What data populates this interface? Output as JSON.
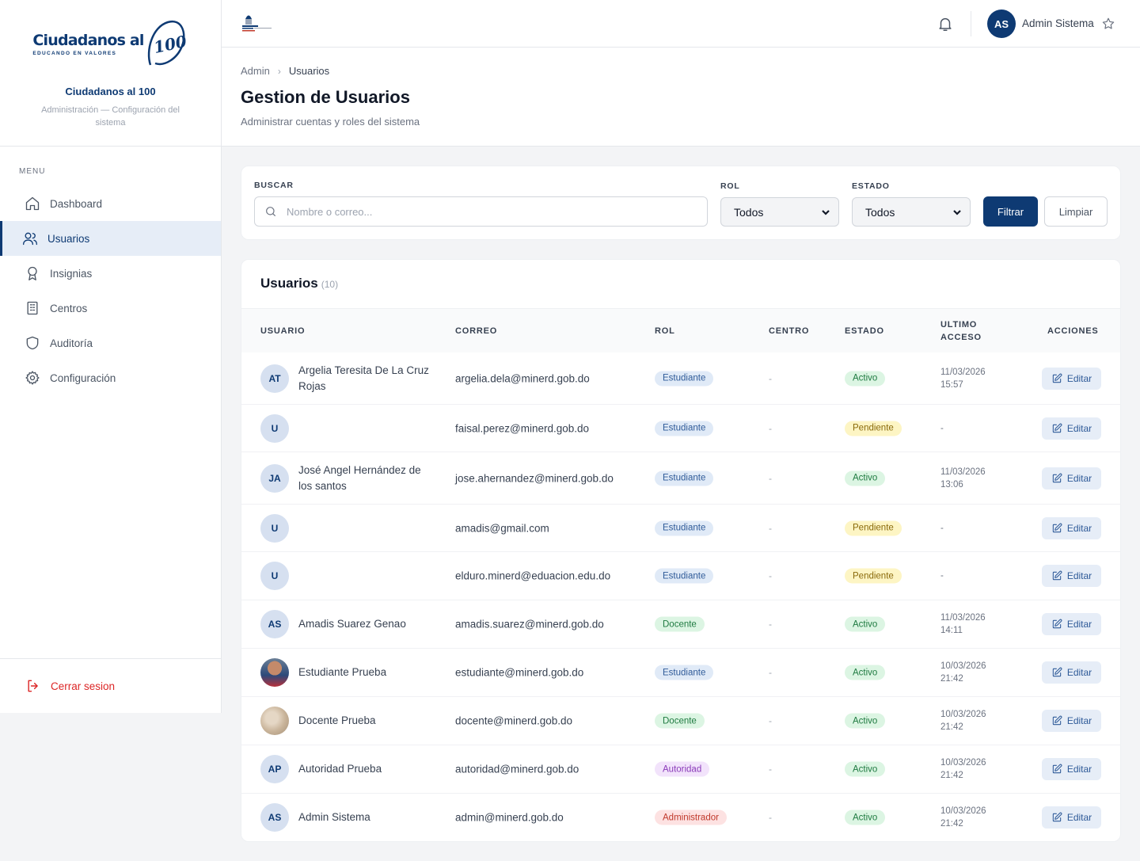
{
  "sidebar": {
    "logo_word": "Ciudadanos al",
    "logo_number": "100",
    "logo_tagline": "EDUCANDO EN VALORES",
    "brand_name": "Ciudadanos al 100",
    "brand_desc": "Administración — Configuración del sistema",
    "menu_title": "MENU",
    "items": [
      {
        "label": "Dashboard",
        "icon": "home-icon"
      },
      {
        "label": "Usuarios",
        "icon": "users-icon",
        "active": true
      },
      {
        "label": "Insignias",
        "icon": "badge-icon"
      },
      {
        "label": "Centros",
        "icon": "building-icon"
      },
      {
        "label": "Auditoría",
        "icon": "shield-icon"
      },
      {
        "label": "Configuración",
        "icon": "gear-icon"
      }
    ],
    "logout": "Cerrar sesion"
  },
  "topbar": {
    "avatar_initials": "AS",
    "user_name": "Admin Sistema"
  },
  "header": {
    "breadcrumb": [
      "Admin",
      "Usuarios"
    ],
    "title": "Gestion de Usuarios",
    "subtitle": "Administrar cuentas y roles del sistema"
  },
  "filters": {
    "search_label": "BUSCAR",
    "search_placeholder": "Nombre o correo...",
    "rol_label": "ROL",
    "rol_value": "Todos",
    "estado_label": "ESTADO",
    "estado_value": "Todos",
    "filter_button": "Filtrar",
    "clear_button": "Limpiar"
  },
  "users": {
    "title": "Usuarios",
    "count": "(10)",
    "columns": [
      "USUARIO",
      "CORREO",
      "ROL",
      "CENTRO",
      "ESTADO",
      "ULTIMO ACCESO",
      "ACCIONES"
    ],
    "edit_label": "Editar",
    "rows": [
      {
        "initials": "AT",
        "name": "Argelia Teresita De La Cruz Rojas",
        "email": "argelia.dela@minerd.gob.do",
        "role": "Estudiante",
        "centro": "-",
        "status": "Activo",
        "last_access": "11/03/2026 15:57"
      },
      {
        "initials": "U",
        "name": "",
        "email": "faisal.perez@minerd.gob.do",
        "role": "Estudiante",
        "centro": "-",
        "status": "Pendiente",
        "last_access": "-"
      },
      {
        "initials": "JA",
        "name": "José Angel Hernández de los santos",
        "email": "jose.ahernandez@minerd.gob.do",
        "role": "Estudiante",
        "centro": "-",
        "status": "Activo",
        "last_access": "11/03/2026 13:06"
      },
      {
        "initials": "U",
        "name": "",
        "email": "amadis@gmail.com",
        "role": "Estudiante",
        "centro": "-",
        "status": "Pendiente",
        "last_access": "-"
      },
      {
        "initials": "U",
        "name": "",
        "email": "elduro.minerd@eduacion.edu.do",
        "role": "Estudiante",
        "centro": "-",
        "status": "Pendiente",
        "last_access": "-"
      },
      {
        "initials": "AS",
        "name": "Amadis Suarez Genao",
        "email": "amadis.suarez@minerd.gob.do",
        "role": "Docente",
        "centro": "-",
        "status": "Activo",
        "last_access": "11/03/2026 14:11"
      },
      {
        "initials": "",
        "name": "Estudiante Prueba",
        "email": "estudiante@minerd.gob.do",
        "role": "Estudiante",
        "centro": "-",
        "status": "Activo",
        "last_access": "10/03/2026 21:42"
      },
      {
        "initials": "",
        "name": "Docente Prueba",
        "email": "docente@minerd.gob.do",
        "role": "Docente",
        "centro": "-",
        "status": "Activo",
        "last_access": "10/03/2026 21:42"
      },
      {
        "initials": "AP",
        "name": "Autoridad Prueba",
        "email": "autoridad@minerd.gob.do",
        "role": "Autoridad",
        "centro": "-",
        "status": "Activo",
        "last_access": "10/03/2026 21:42"
      },
      {
        "initials": "AS",
        "name": "Admin Sistema",
        "email": "admin@minerd.gob.do",
        "role": "Administrador",
        "centro": "-",
        "status": "Activo",
        "last_access": "10/03/2026 21:42"
      }
    ]
  },
  "colors": {
    "brand": "#0e3a73",
    "danger": "#dc2626"
  }
}
